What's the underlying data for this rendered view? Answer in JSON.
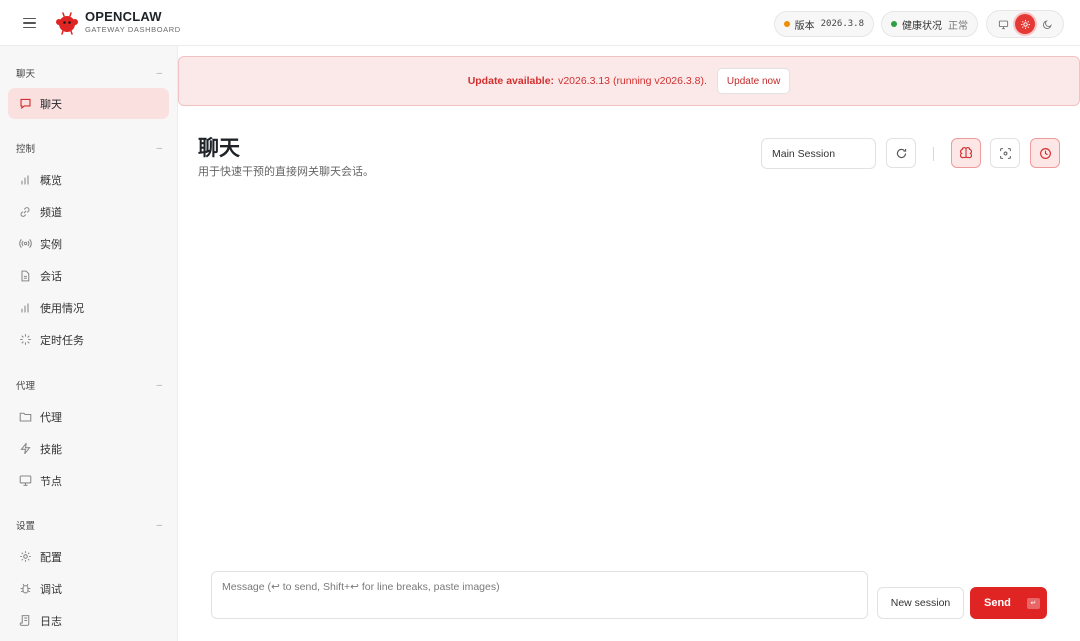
{
  "header": {
    "brand_title": "OPENCLAW",
    "brand_subtitle": "GATEWAY DASHBOARD",
    "version_label": "版本",
    "version_value": "2026.3.8",
    "health_label": "健康状况",
    "health_value": "正常",
    "colors": {
      "version_dot": "#f08c00",
      "health_dot": "#2ea043",
      "accent": "#e02424"
    }
  },
  "sidebar": {
    "groups": [
      {
        "label": "聊天",
        "collapse": "–",
        "items": [
          {
            "label": "聊天",
            "icon": "message-icon"
          }
        ]
      },
      {
        "label": "控制",
        "collapse": "–",
        "items": [
          {
            "label": "概览",
            "icon": "bar-chart-icon"
          },
          {
            "label": "频道",
            "icon": "link-icon"
          },
          {
            "label": "实例",
            "icon": "radio-icon"
          },
          {
            "label": "会话",
            "icon": "file-icon"
          },
          {
            "label": "使用情况",
            "icon": "bar-chart-icon"
          },
          {
            "label": "定时任务",
            "icon": "loader-icon"
          }
        ]
      },
      {
        "label": "代理",
        "collapse": "–",
        "items": [
          {
            "label": "代理",
            "icon": "folder-icon"
          },
          {
            "label": "技能",
            "icon": "zap-icon"
          },
          {
            "label": "节点",
            "icon": "monitor-icon"
          }
        ]
      },
      {
        "label": "设置",
        "collapse": "–",
        "items": [
          {
            "label": "配置",
            "icon": "gear-icon"
          },
          {
            "label": "调试",
            "icon": "bug-icon"
          },
          {
            "label": "日志",
            "icon": "scroll-icon"
          }
        ]
      }
    ]
  },
  "banner": {
    "prefix": "Update available:",
    "message": "v2026.3.13 (running v2026.3.8).",
    "button": "Update now"
  },
  "main": {
    "title": "聊天",
    "subtitle": "用于快速干预的直接网关聊天会话。",
    "session_select": "Main Session"
  },
  "composer": {
    "placeholder": "Message (↩ to send, Shift+↩ for line breaks, paste images)",
    "new_session": "New session",
    "send": "Send",
    "send_key": "↵"
  }
}
